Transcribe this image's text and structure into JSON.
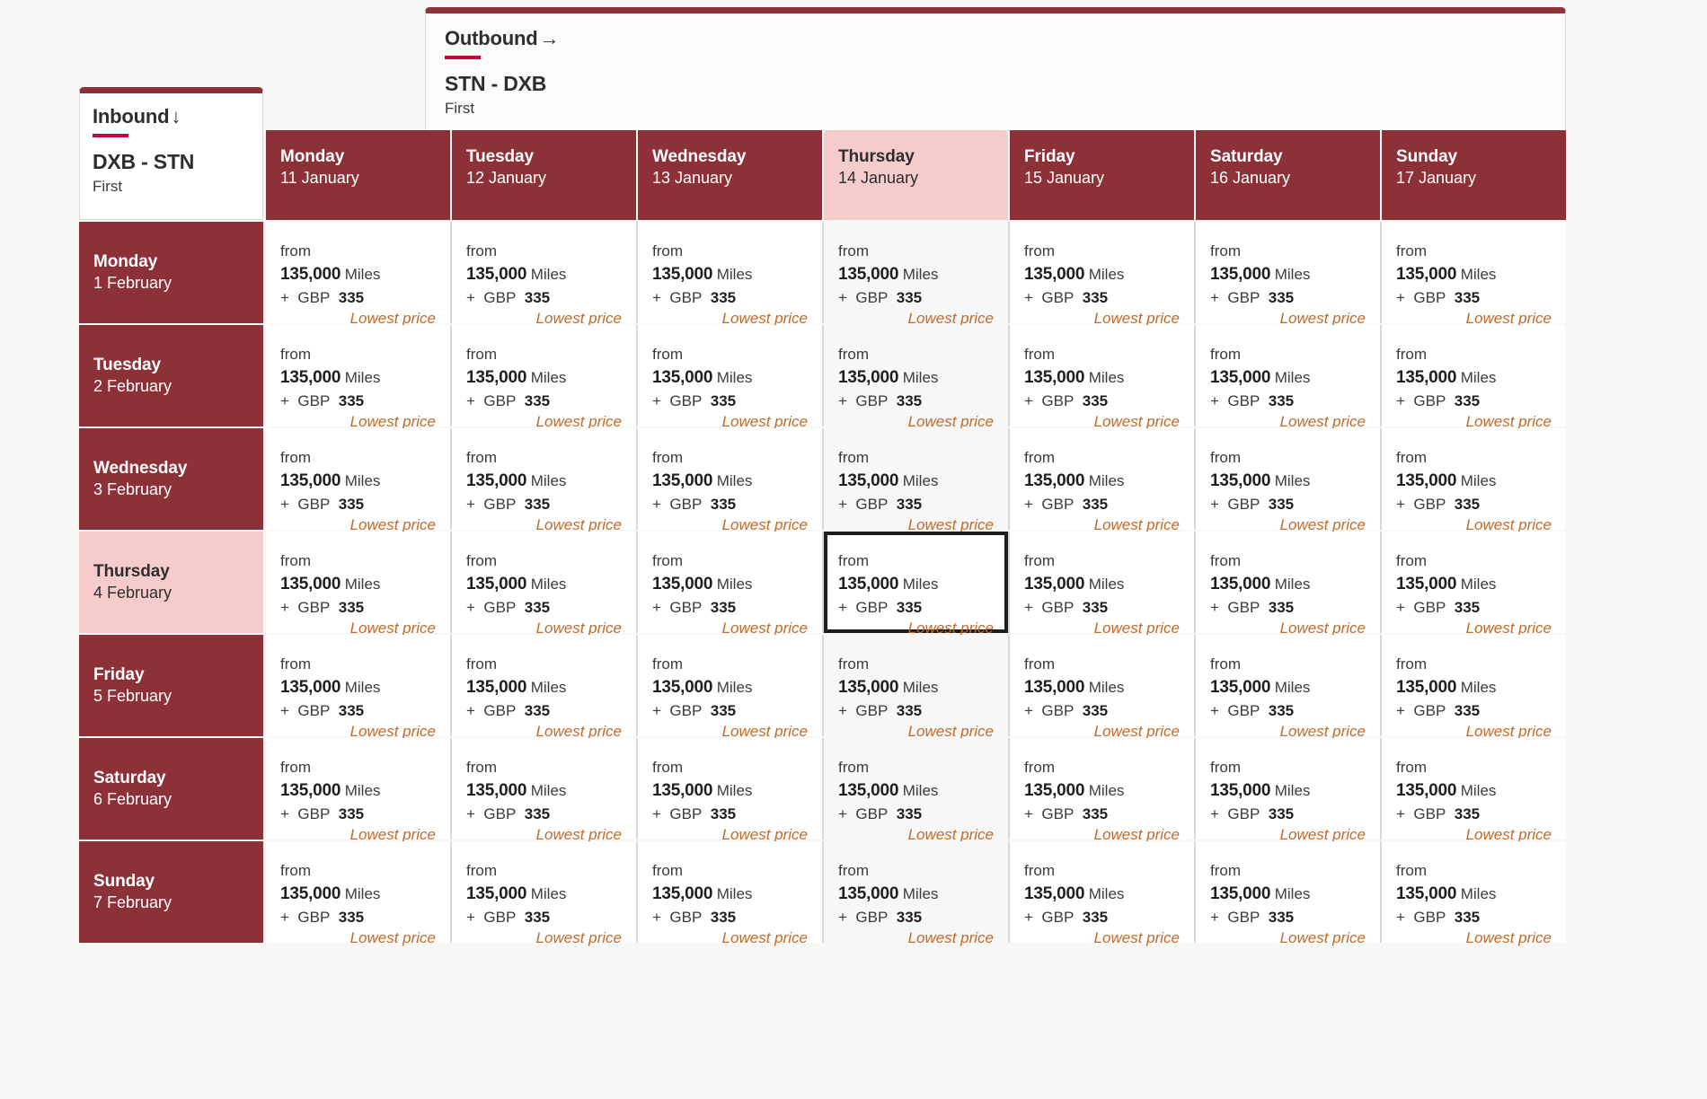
{
  "outbound": {
    "direction_label": "Outbound",
    "direction_icon": "arrow-right",
    "arrow": "→",
    "route": "STN - DXB",
    "cabin": "First"
  },
  "inbound": {
    "direction_label": "Inbound",
    "direction_icon": "arrow-down",
    "arrow": "↓",
    "route": "DXB - STN",
    "cabin": "First"
  },
  "colors": {
    "brand_red": "#8c3137",
    "accent_red": "#c5003e",
    "highlight_pink": "#f5cccb",
    "lowest_price_orange": "#c26a28",
    "selected_border": "#1c1c1c",
    "page_background": "#f7f7f6"
  },
  "columns": [
    {
      "dow": "Monday",
      "date": "11 January",
      "highlight": false
    },
    {
      "dow": "Tuesday",
      "date": "12 January",
      "highlight": false
    },
    {
      "dow": "Wednesday",
      "date": "13 January",
      "highlight": false
    },
    {
      "dow": "Thursday",
      "date": "14 January",
      "highlight": true
    },
    {
      "dow": "Friday",
      "date": "15 January",
      "highlight": false
    },
    {
      "dow": "Saturday",
      "date": "16 January",
      "highlight": false
    },
    {
      "dow": "Sunday",
      "date": "17 January",
      "highlight": false
    }
  ],
  "rows": [
    {
      "dow": "Monday",
      "date": "1 February",
      "highlight": false
    },
    {
      "dow": "Tuesday",
      "date": "2 February",
      "highlight": false
    },
    {
      "dow": "Wednesday",
      "date": "3 February",
      "highlight": false
    },
    {
      "dow": "Thursday",
      "date": "4 February",
      "highlight": true
    },
    {
      "dow": "Friday",
      "date": "5 February",
      "highlight": false
    },
    {
      "dow": "Saturday",
      "date": "6 February",
      "highlight": false
    },
    {
      "dow": "Sunday",
      "date": "7 February",
      "highlight": false
    }
  ],
  "cell_template": {
    "from_label": "from",
    "miles_value": "135,000",
    "miles_unit": "Miles",
    "plus_label": "+",
    "currency": "GBP",
    "cash_value": "335",
    "lowest_price_label": "Lowest price"
  },
  "selected_cell": {
    "row": 3,
    "column": 3
  },
  "highlighted_column_index": 3,
  "highlighted_row_index": 3
}
